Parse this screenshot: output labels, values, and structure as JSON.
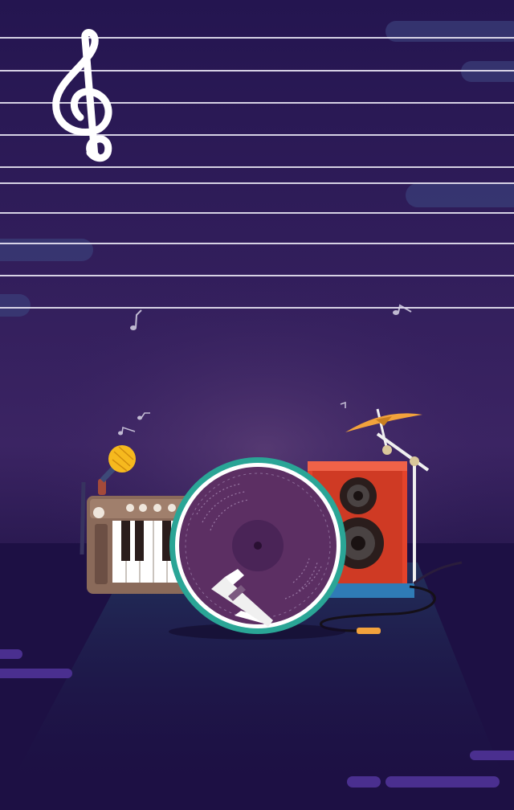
{
  "scene": {
    "background_top": "#241550",
    "background_mid": "#3a2262",
    "floor_color": "#1b1040",
    "staff_line_color": "#e9e6f4",
    "staff_line_count": 9,
    "accent_teal": "#2aa596",
    "speaker_red": "#e4432b",
    "cymbal_gold": "#f2a23c",
    "mic_yellow": "#f6b91e"
  },
  "icons": {
    "clef": "treble-clef-icon",
    "notes": "music-note-icon",
    "instruments": [
      "keyboard-synth",
      "microphone",
      "vinyl-record",
      "turntable-arm",
      "speaker-amplifier",
      "cymbal-stand",
      "audio-cable"
    ]
  }
}
